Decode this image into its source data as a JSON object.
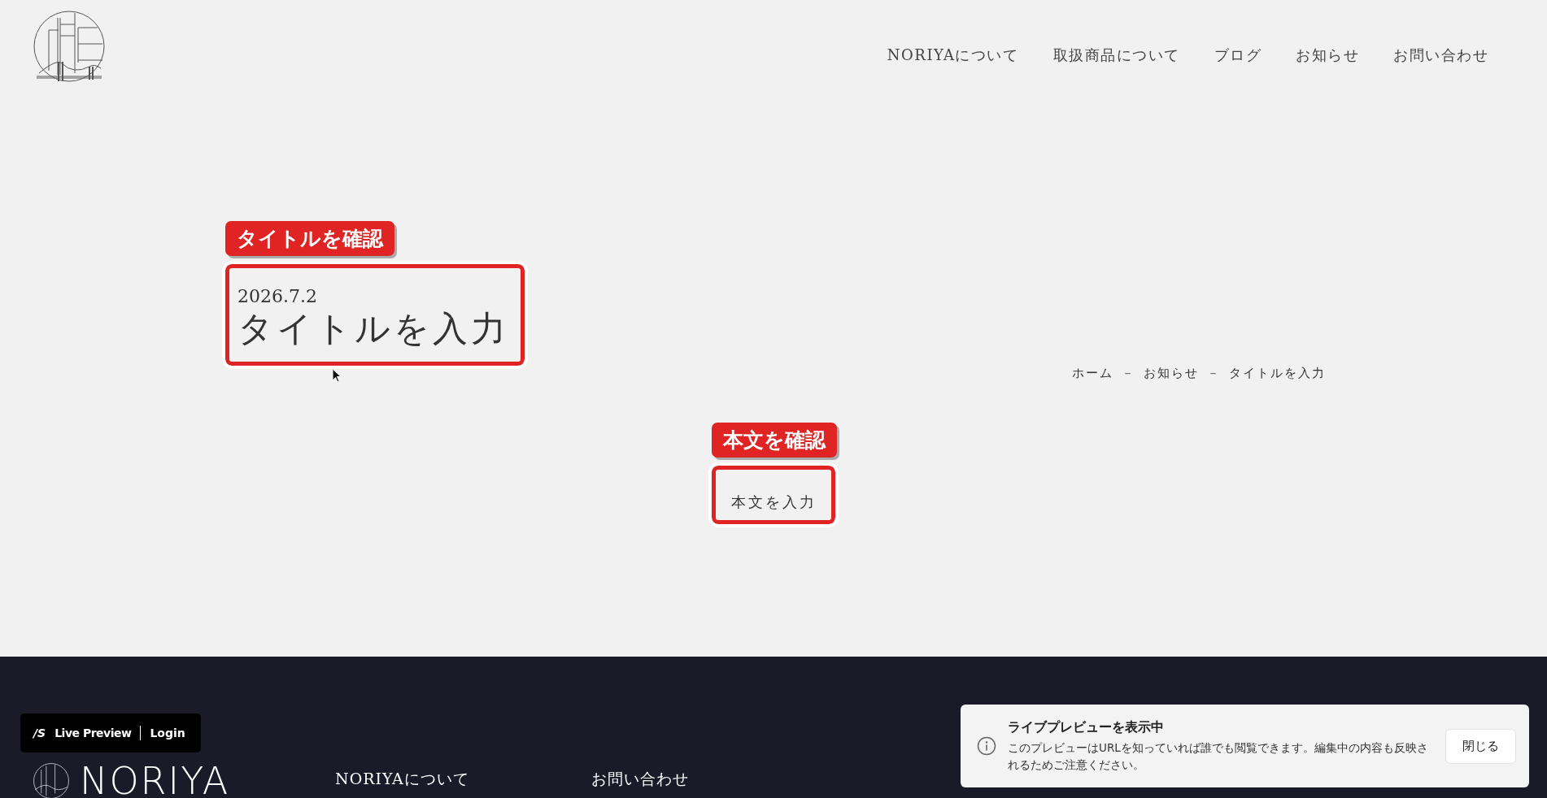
{
  "header": {
    "nav": [
      "NORIYAについて",
      "取扱商品について",
      "ブログ",
      "お知らせ",
      "お問い合わせ"
    ]
  },
  "title_section": {
    "callout": "タイトルを確認",
    "date": "2026.7.2",
    "title": "タイトルを入力"
  },
  "breadcrumb": {
    "items": [
      "ホーム",
      "お知らせ",
      "タイトルを入力"
    ],
    "separator": "－"
  },
  "body_section": {
    "callout": "本文を確認",
    "text": "本文を入力"
  },
  "footer": {
    "brand": "NORIYA",
    "links": [
      "NORIYAについて",
      "お問い合わせ"
    ]
  },
  "preview_bar": {
    "logo": "/S",
    "label": "Live Preview",
    "login": "Login"
  },
  "toast": {
    "title": "ライブプレビューを表示中",
    "message": "このプレビューはURLを知っていれば誰でも閲覧できます。編集中の内容も反映されるためご注意ください。",
    "button": "閉じる"
  }
}
